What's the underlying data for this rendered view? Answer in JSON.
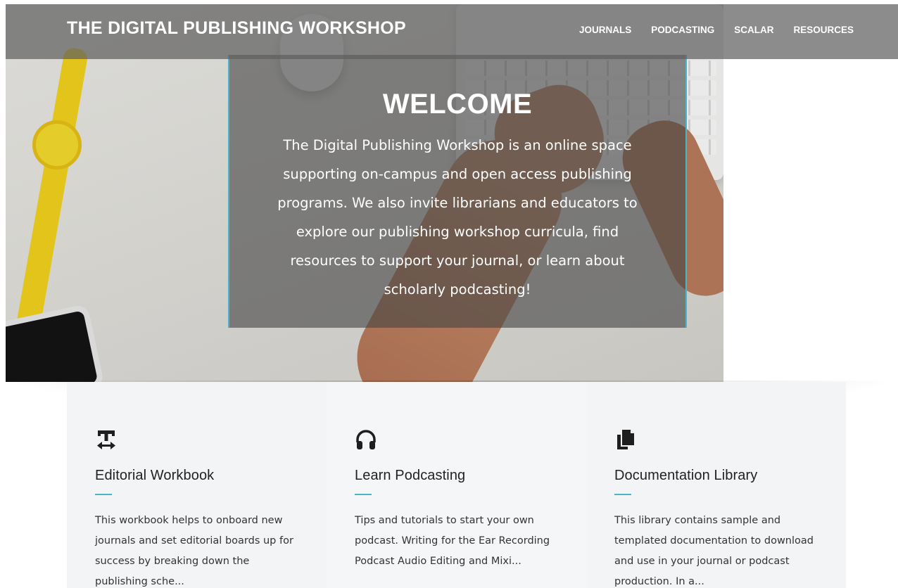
{
  "header": {
    "site_title": "THE DIGITAL PUBLISHING WORKSHOP",
    "nav": [
      {
        "label": "JOURNALS"
      },
      {
        "label": "PODCASTING"
      },
      {
        "label": "SCALAR"
      },
      {
        "label": "RESOURCES"
      }
    ]
  },
  "hero": {
    "title": "WELCOME",
    "text": "The Digital Publishing Workshop is an online space supporting on-campus and open access publishing programs. We also invite librarians and educators to explore our publishing workshop curricula, find resources to support your journal, or learn about scholarly podcasting!"
  },
  "cards": [
    {
      "icon": "text-width-icon",
      "title": "Editorial Workbook",
      "description": "This workbook helps to onboard new journals and set editorial boards up for success by breaking down the publishing sche..."
    },
    {
      "icon": "headphones-icon",
      "title": "Learn Podcasting",
      "description": "Tips and tutorials to start your own podcast. Writing for the Ear Recording Podcast Audio Editing and Mixi..."
    },
    {
      "icon": "copy-documents-icon",
      "title": "Documentation Library",
      "description": "This library contains sample and templated documentation to download and use in your journal or podcast production. In a..."
    }
  ],
  "colors": {
    "accent": "#49b5c7",
    "navbar_bg": "#5f5f5f",
    "card_bg": "#f3f4f6",
    "text_dark": "#222222"
  }
}
